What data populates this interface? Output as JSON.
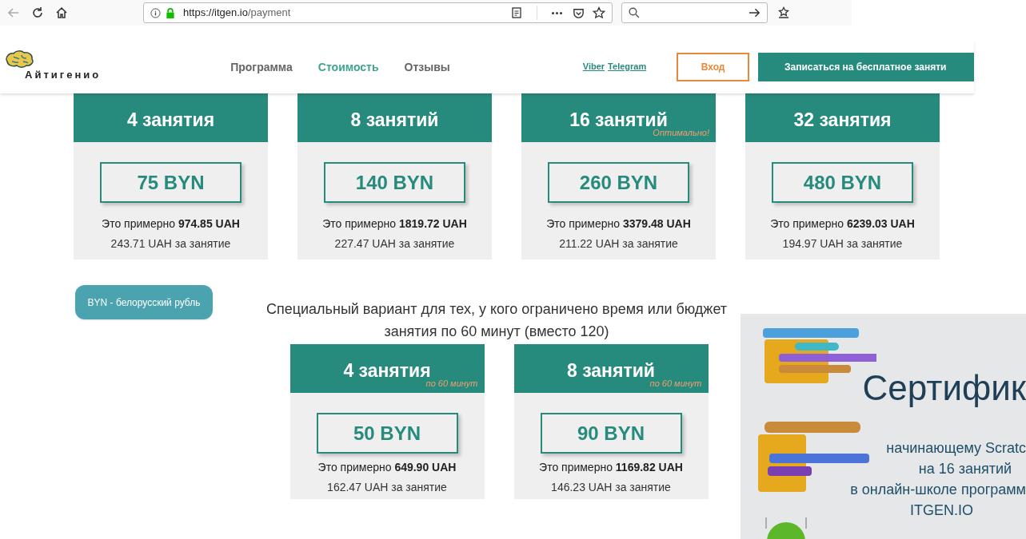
{
  "browser": {
    "url_host": "https://itgen.io",
    "url_path": "/payment",
    "back_disabled": true
  },
  "header": {
    "logo": "Айтигенио",
    "nav": [
      {
        "label": "Программа",
        "selected": false
      },
      {
        "label": "Стоимость",
        "selected": true
      },
      {
        "label": "Отзывы",
        "selected": false
      }
    ],
    "messengers": [
      "Viber",
      "Telegram"
    ],
    "login": "Вход",
    "signup": "Записаться на бесплатное заняти"
  },
  "plans": [
    {
      "title": "4 занятия",
      "price": "75 BYN",
      "approx": "Это примерно **974.85 UAH**",
      "per_lesson": "243.71 UAH за занятие"
    },
    {
      "title": "8 занятий",
      "price": "140 BYN",
      "approx": "Это примерно **1819.72 UAH**",
      "per_lesson": "227.47 UAH за занятие"
    },
    {
      "title": "16 занятий",
      "note": "Оптимально!",
      "price": "260 BYN",
      "approx": "Это примерно **3379.48 UAH**",
      "per_lesson": "211.22 UAH за занятие"
    },
    {
      "title": "32 занятия",
      "price": "480 BYN",
      "approx": "Это примерно **6239.03 UAH**",
      "per_lesson": "194.97 UAH за занятие"
    }
  ],
  "currency_badge": "BYN - белорусский рубль",
  "special": {
    "line_1": "Специальный вариант для тех, у кого ограничено время или бюджет",
    "line_2": "занятия по 60 минут (вместо 120)",
    "plans": [
      {
        "title": "4 занятия",
        "note": "по 60 минут",
        "price": "50 BYN",
        "approx": "Это примерно **649.90 UAH**",
        "per_lesson": "162.47 UAH за занятие"
      },
      {
        "title": "8 занятий",
        "note": "по 60 минут",
        "price": "90 BYN",
        "approx": "Это примерно **1169.82 UAH**",
        "per_lesson": "146.23 UAH за занятие"
      }
    ]
  },
  "certificate": {
    "title": "Сертифик",
    "lines": [
      "начинающему Scratc",
      "на 16 занятий",
      "в онлайн-школе программ",
      "ITGEN.IO"
    ]
  }
}
